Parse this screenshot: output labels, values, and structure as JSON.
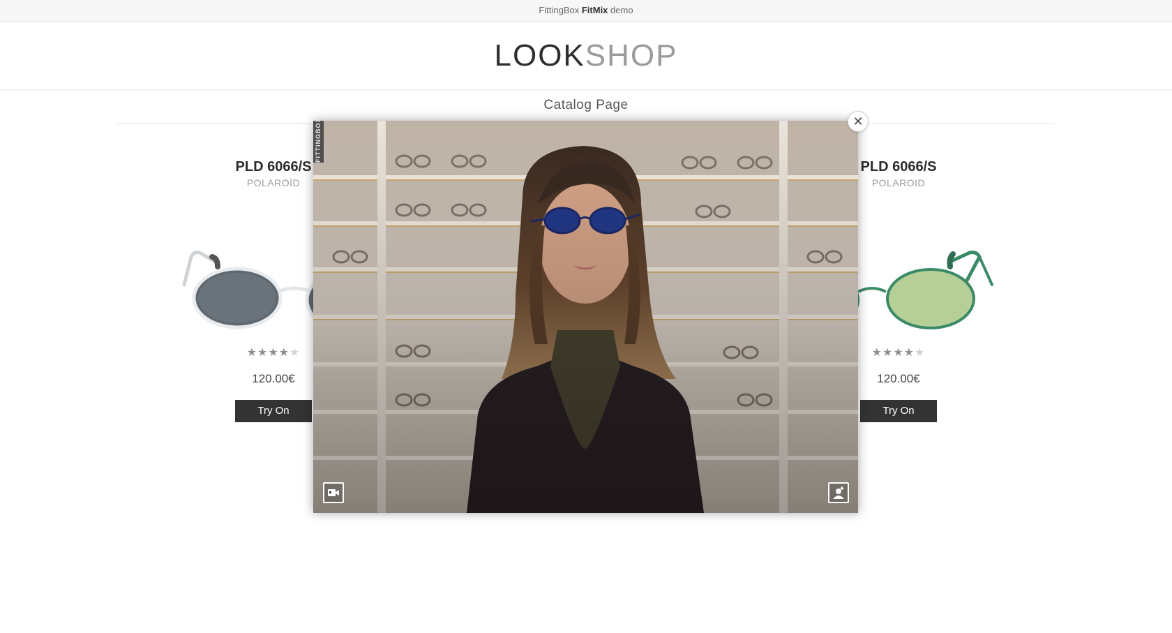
{
  "topbar": {
    "prefix": "FittingBox",
    "brand": "FitMix",
    "suffix": "demo"
  },
  "header": {
    "logo_look": "LOOK",
    "logo_shop": "SHOP"
  },
  "page": {
    "title": "Catalog Page"
  },
  "products": [
    {
      "name": "PLD 6066/S",
      "brand": "POLAROÏD",
      "rating": 4,
      "rating_max": 5,
      "price": "120.00€",
      "button": "Try On",
      "frame_color": "#e9ecee",
      "lens_color": "#5f6870"
    },
    {
      "name": "PLD 6066/S",
      "brand": "POLAROID",
      "rating": 4,
      "rating_max": 5,
      "price": "120.00€",
      "button": "Try On",
      "frame_color": "#3b8a67",
      "lens_color": "#b5cf96"
    }
  ],
  "modal": {
    "watermark": "FITTINGBOX",
    "video_button_icon": "video-camera-icon",
    "add_photo_button_icon": "add-portrait-icon",
    "close_icon": "close-icon"
  }
}
